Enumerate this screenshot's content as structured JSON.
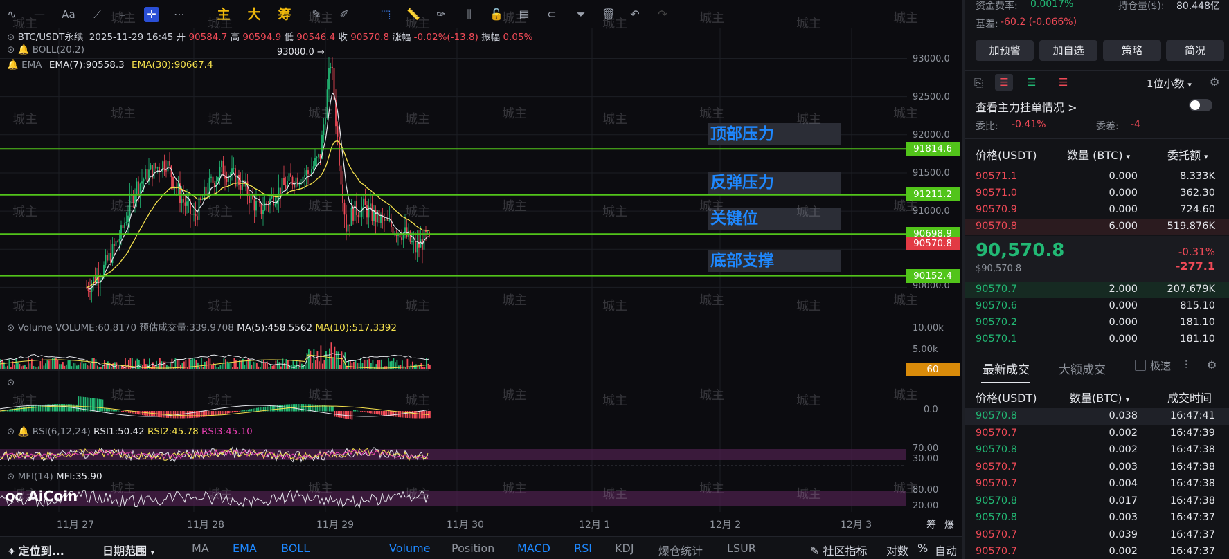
{
  "toolbar": {
    "main_label": "主",
    "big_label": "大",
    "chip_label": "筹"
  },
  "header": {
    "symbol": "BTC/USDT永续",
    "datetime": "2025-11-29 16:45",
    "open_label": "开",
    "open": "90584.7",
    "high_label": "高",
    "high": "90594.9",
    "low_label": "低",
    "low": "90546.4",
    "close_label": "收",
    "close": "90570.8",
    "change_label": "涨幅",
    "change": "-0.02%(-13.8)",
    "amp_label": "振幅",
    "amp": "0.05%"
  },
  "indicators": {
    "boll": "BOLL(20,2)",
    "ema_label": "EMA",
    "ema7": "EMA(7):90558.3",
    "ema30": "EMA(30):90667.4",
    "volume_label": "Volume",
    "volume_value": "VOLUME:60.8170",
    "vol_est": "预估成交量:339.9708",
    "vol_ma5": "MA(5):458.5562",
    "vol_ma10": "MA(10):517.3392",
    "rsi_label": "RSI(6,12,24)",
    "rsi1": "RSI1:50.42",
    "rsi2": "RSI2:45.78",
    "rsi3": "RSI3:45.10",
    "mfi_label": "MFI(14)",
    "mfi_value": "MFI:35.90"
  },
  "chart": {
    "peak_label": "93080.0 →",
    "levels": [
      {
        "name": "顶部压力",
        "price": "91814.6"
      },
      {
        "name": "反弹压力",
        "price": "91211.2"
      },
      {
        "name": "关键位",
        "price": "90698.9"
      },
      {
        "name": "底部支撑",
        "price": "90152.4"
      }
    ],
    "current_price": "90570.8",
    "price_axis": [
      "93000.0",
      "92500.0",
      "92000.0",
      "91500.0",
      "91000.0",
      "90000.0"
    ],
    "volume_axis": [
      "10.00k",
      "5.00k"
    ],
    "volume_tag": "60",
    "macd_axis": "0.0",
    "rsi_axis": [
      "70.00",
      "30.00"
    ],
    "mfi_axis": [
      "80.00",
      "20.00"
    ],
    "dates": [
      "11月 27",
      "11月 28",
      "11月 29",
      "11月 30",
      "12月 1",
      "12月 2",
      "12月 3"
    ],
    "watermark": "城主",
    "logo": "AiCoin",
    "right_corner": [
      "筹",
      "爆"
    ]
  },
  "bottom": {
    "locate": "定位到...",
    "date_range": "日期范围",
    "items": [
      "MA",
      "EMA",
      "BOLL",
      "Volume",
      "Position",
      "MACD",
      "RSI",
      "KDJ",
      "爆仓统计",
      "LSUR"
    ],
    "community": "社区指标",
    "log": "对数",
    "pct": "%",
    "auto": "自动"
  },
  "side": {
    "funding_label": "资金费率:",
    "funding": "0.0017%",
    "oi_label": "持仓量($):",
    "oi": "80.448亿",
    "basis_label": "基差:",
    "basis": "-60.2 (-0.066%)",
    "buttons": [
      "加预警",
      "加自选",
      "策略",
      "简况"
    ],
    "decimals": "1位小数",
    "main_orders": "查看主力挂单情况 >",
    "weibi_label": "委比:",
    "weibi": "-0.41%",
    "weicha_label": "委差:",
    "weicha": "-4",
    "cols": [
      "价格(USDT)",
      "数量 (BTC)",
      "委托额"
    ],
    "asks": [
      {
        "p": "90571.1",
        "q": "0.000",
        "t": "8.333K"
      },
      {
        "p": "90571.0",
        "q": "0.000",
        "t": "362.30"
      },
      {
        "p": "90570.9",
        "q": "0.000",
        "t": "724.60"
      },
      {
        "p": "90570.8",
        "q": "6.000",
        "t": "519.876K"
      }
    ],
    "last_price": "90,570.8",
    "last_usd": "$90,570.8",
    "pct_change": "-0.31%",
    "abs_change": "-277.1",
    "bids": [
      {
        "p": "90570.7",
        "q": "2.000",
        "t": "207.679K"
      },
      {
        "p": "90570.6",
        "q": "0.000",
        "t": "815.10"
      },
      {
        "p": "90570.2",
        "q": "0.000",
        "t": "181.10"
      },
      {
        "p": "90570.1",
        "q": "0.000",
        "t": "181.10"
      }
    ],
    "tabs": [
      "最新成交",
      "大额成交"
    ],
    "fast_label": "极速",
    "trade_cols": [
      "价格(USDT)",
      "数量(BTC)",
      "成交时间"
    ],
    "trades": [
      {
        "p": "90570.8",
        "q": "0.038",
        "t": "16:47:41",
        "side": "buy"
      },
      {
        "p": "90570.7",
        "q": "0.002",
        "t": "16:47:39",
        "side": "sell"
      },
      {
        "p": "90570.8",
        "q": "0.002",
        "t": "16:47:38",
        "side": "buy"
      },
      {
        "p": "90570.7",
        "q": "0.003",
        "t": "16:47:38",
        "side": "sell"
      },
      {
        "p": "90570.7",
        "q": "0.004",
        "t": "16:47:38",
        "side": "sell"
      },
      {
        "p": "90570.8",
        "q": "0.017",
        "t": "16:47:38",
        "side": "buy"
      },
      {
        "p": "90570.8",
        "q": "0.003",
        "t": "16:47:37",
        "side": "buy"
      },
      {
        "p": "90570.7",
        "q": "0.039",
        "t": "16:47:37",
        "side": "sell"
      },
      {
        "p": "90570.7",
        "q": "0.002",
        "t": "16:47:37",
        "side": "sell"
      }
    ]
  },
  "colors": {
    "up": "#22b874",
    "down": "#f04a57",
    "level": "#52c41a",
    "accent": "#1e88ff"
  }
}
